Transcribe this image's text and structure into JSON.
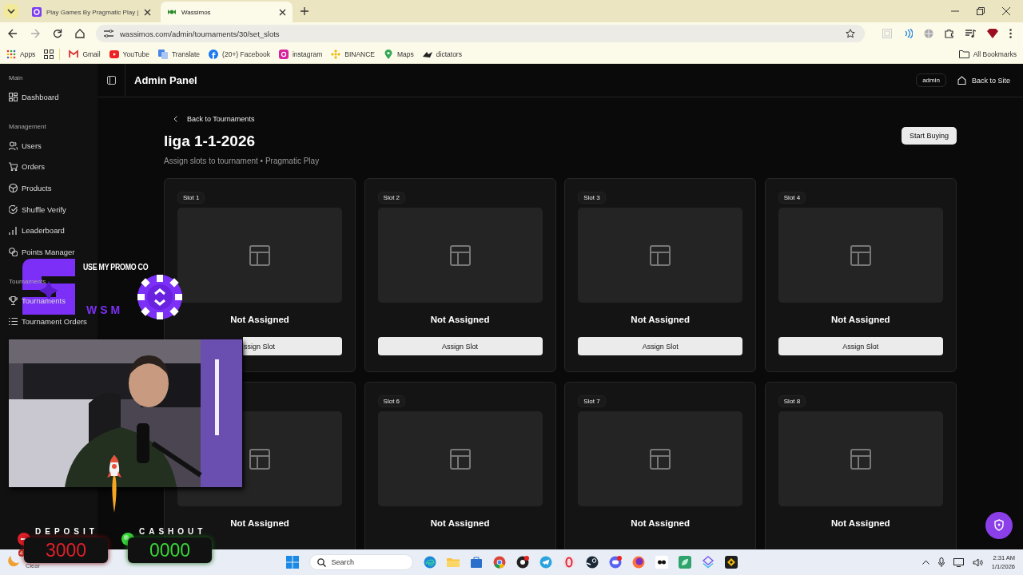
{
  "browser": {
    "tabs": [
      {
        "title": "Play Games By Pragmatic Play |",
        "selected": false
      },
      {
        "title": "Wassimos",
        "selected": true
      }
    ],
    "url": "wassimos.com/admin/tournaments/30/set_slots",
    "bookmarks": [
      {
        "label": "Apps"
      },
      {
        "label": "Gmail"
      },
      {
        "label": "YouTube"
      },
      {
        "label": "Translate"
      },
      {
        "label": "(20+) Facebook"
      },
      {
        "label": "instagram"
      },
      {
        "label": "BINANCE"
      },
      {
        "label": "Maps"
      },
      {
        "label": "dictators"
      }
    ],
    "all_bookmarks": "All Bookmarks"
  },
  "sidebar": {
    "groups": [
      {
        "label": "Main",
        "items": [
          {
            "label": "Dashboard"
          }
        ]
      },
      {
        "label": "Management",
        "items": [
          {
            "label": "Users"
          },
          {
            "label": "Orders"
          },
          {
            "label": "Products"
          },
          {
            "label": "Shuffle Verify"
          },
          {
            "label": "Leaderboard"
          },
          {
            "label": "Points Manager"
          }
        ]
      },
      {
        "label": "Tournaments",
        "items": [
          {
            "label": "Tournaments"
          },
          {
            "label": "Tournament Orders"
          }
        ]
      }
    ]
  },
  "header": {
    "title": "Admin Panel",
    "user": "admin",
    "back_link": "Back to Site"
  },
  "page": {
    "back_link": "Back to Tournaments",
    "title": "liga 1-1-2026",
    "subtitle": "Assign slots to tournament • Pragmatic Play",
    "action": "Start Buying"
  },
  "slots": [
    {
      "label": "Slot 1",
      "status": "Not Assigned",
      "button": "ssign Slot"
    },
    {
      "label": "Slot 2",
      "status": "Not Assigned",
      "button": "Assign Slot"
    },
    {
      "label": "Slot 3",
      "status": "Not Assigned",
      "button": "Assign Slot"
    },
    {
      "label": "Slot 4",
      "status": "Not Assigned",
      "button": "Assign Slot"
    },
    {
      "status": "Not Assigned"
    },
    {
      "label": "Slot 6",
      "status": "Not Assigned"
    },
    {
      "label": "Slot 7",
      "status": "Not Assigned"
    },
    {
      "label": "Slot 8",
      "status": "Not Assigned"
    }
  ],
  "stream_overlay": {
    "promo_text": "USE MY PROMO CO",
    "brand": "WSM",
    "deposit": {
      "label": "DEPOSIT",
      "value": "3000"
    },
    "cashout": {
      "label": "CASHOUT",
      "value": "0000"
    }
  },
  "taskbar": {
    "weather": {
      "badge": "4",
      "text": "Clear"
    },
    "search_placeholder": "Search",
    "time": "2:31 AM",
    "date": "1/1/2026"
  }
}
